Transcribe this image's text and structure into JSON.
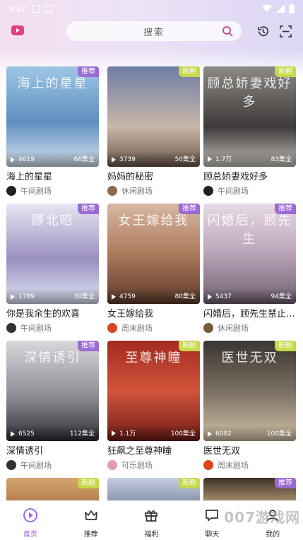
{
  "status_bar": {
    "time": "9:57"
  },
  "header": {
    "search_placeholder": "搜索"
  },
  "rows": [
    [
      {
        "title": "海上的星星",
        "poster_art": "海上的星星",
        "tag": "推荐",
        "views": "4619",
        "episodes": "66集全",
        "channel": "午间剧场"
      },
      {
        "title": "妈妈的秘密",
        "poster_art": "",
        "tag": "新剧",
        "views": "3739",
        "episodes": "50集全",
        "channel": "休闲剧场"
      },
      {
        "title": "顾总娇妻戏好多",
        "poster_art": "顾总娇妻戏好多",
        "tag": "新剧",
        "views": "1.7万",
        "episodes": "83集全",
        "channel": "午间剧场"
      }
    ],
    [
      {
        "title": "你是我余生的欢喜",
        "poster_art": "顾北昭",
        "tag": "推荐",
        "views": "1789",
        "episodes": "30集全",
        "channel": "午间剧场"
      },
      {
        "title": "女王嫁给我",
        "poster_art": "女王嫁给我",
        "tag": "推荐",
        "views": "4759",
        "episodes": "80集全",
        "channel": "周末剧场"
      },
      {
        "title": "闪婚后，顾先生禁止...",
        "poster_art": "闪婚后，顾先生",
        "tag": "推荐",
        "views": "5437",
        "episodes": "94集全",
        "channel": "休闲剧场"
      }
    ],
    [
      {
        "title": "深情诱引",
        "poster_art": "深情诱引",
        "tag": "推荐",
        "views": "6525",
        "episodes": "112集全",
        "channel": "午间剧场"
      },
      {
        "title": "狂飙之至尊神瞳",
        "poster_art": "至尊神瞳",
        "tag": "新剧",
        "views": "1.1万",
        "episodes": "100集全",
        "channel": "可乐剧场"
      },
      {
        "title": "医世无双",
        "poster_art": "医世无双",
        "tag": "新剧",
        "views": "6082",
        "episodes": "100集全",
        "channel": "周末剧场"
      }
    ],
    [
      {
        "title": "",
        "poster_art": "",
        "tag": "新剧",
        "views": "",
        "episodes": "",
        "channel": ""
      },
      {
        "title": "",
        "poster_art": "",
        "tag": "新剧",
        "views": "",
        "episodes": "",
        "channel": ""
      },
      {
        "title": "",
        "poster_art": "",
        "tag": "推荐",
        "views": "",
        "episodes": "",
        "channel": ""
      }
    ]
  ],
  "nav": [
    {
      "label": "首页",
      "icon": "play-circle-icon",
      "active": true
    },
    {
      "label": "推荐",
      "icon": "crown-icon",
      "active": false
    },
    {
      "label": "福利",
      "icon": "gift-icon",
      "active": false
    },
    {
      "label": "聊天",
      "icon": "chat-icon",
      "active": false
    },
    {
      "label": "我的",
      "icon": "profile-icon",
      "active": false
    }
  ],
  "watermark": "007游戏网",
  "colors": {
    "accent": "#9b5de5",
    "tag_recommend": "#9b6ad6",
    "tag_new": "#c7d84a"
  }
}
